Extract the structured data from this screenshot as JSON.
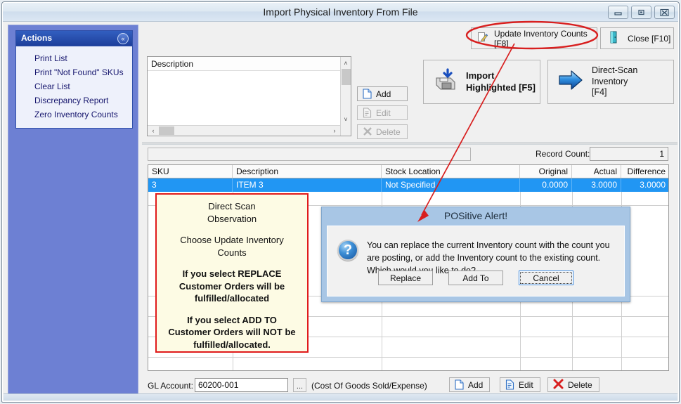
{
  "window": {
    "title": "Import Physical Inventory From File",
    "controls": [
      {
        "name": "minimize",
        "glyph": "–"
      },
      {
        "name": "restore",
        "glyph": "□"
      },
      {
        "name": "close",
        "glyph": "✕"
      }
    ]
  },
  "sidebar": {
    "header": "Actions",
    "collapse_glyph": "«",
    "items": [
      {
        "label": "Print List"
      },
      {
        "label": "Print \"Not Found\" SKUs"
      },
      {
        "label": "Clear List"
      },
      {
        "label": "Discrepancy Report"
      },
      {
        "label": "Zero Inventory Counts"
      }
    ]
  },
  "toolbar": {
    "update_label": "Update Inventory Counts [F8]",
    "update_icon": "pencil-edit-icon",
    "close_label": "Close [F10]",
    "close_icon": "exit-door-icon"
  },
  "description_panel": {
    "header": "Description",
    "buttons": [
      {
        "label": "Add",
        "icon": "new-page-icon",
        "enabled": true
      },
      {
        "label": "Edit",
        "icon": "edit-page-icon",
        "enabled": false
      },
      {
        "label": "Delete",
        "icon": "delete-x-icon",
        "enabled": false
      }
    ],
    "scroll": {
      "up_glyph": "˄",
      "down_glyph": "˅",
      "left_glyph": "‹",
      "right_glyph": "›"
    }
  },
  "action_buttons": [
    {
      "name": "import-highlighted",
      "line1": "Import",
      "line2": "Highlighted [F5]",
      "icon": "floppy-import-icon",
      "bold": true
    },
    {
      "name": "direct-scan-inventory",
      "line1": "Direct-Scan Inventory",
      "line2": "[F4]",
      "icon": "blue-arrow-right-icon",
      "bold": false
    }
  ],
  "grid": {
    "filter_value": "",
    "record_count_label": "Record Count:",
    "record_count_value": "1",
    "columns": [
      "SKU",
      "Description",
      "Stock Location",
      "Original",
      "Actual",
      "Difference"
    ],
    "rows": [
      {
        "sku": "3",
        "description": "ITEM 3",
        "stock_location": "Not Specified",
        "original": "0.0000",
        "actual": "3.0000",
        "difference": "3.0000",
        "selected": true
      }
    ]
  },
  "note": {
    "paragraphs": [
      "Direct Scan\nObservation",
      "Choose Update Inventory\nCounts",
      "If you select REPLACE\nCustomer Orders will be\nfulfilled/allocated",
      "If you select ADD TO\nCustomer Orders will NOT be\nfulfilled/allocated."
    ]
  },
  "alert": {
    "title": "POSitive Alert!",
    "icon": "question-mark-icon",
    "icon_glyph": "?",
    "message": "You can replace the current Inventory count with the count you are posting, or add the Inventory count to the existing count.  Which would you like to do?",
    "buttons": [
      {
        "label": "Replace",
        "focused": false
      },
      {
        "label": "Add To",
        "focused": false
      },
      {
        "label": "Cancel",
        "focused": true
      }
    ]
  },
  "footer": {
    "gl_label": "GL Account:",
    "gl_value": "60200-001",
    "browse_label": "...",
    "gl_hint": "(Cost Of Goods Sold/Expense)",
    "buttons": [
      {
        "label": "Add",
        "icon": "new-page-icon"
      },
      {
        "label": "Edit",
        "icon": "edit-page-icon"
      },
      {
        "label": "Delete",
        "icon": "red-x-icon"
      }
    ]
  },
  "annotation": {
    "color": "#d81f1f",
    "ellipse_target": "update-inventory-counts-button",
    "arrow_target": "positive-alert-title"
  }
}
